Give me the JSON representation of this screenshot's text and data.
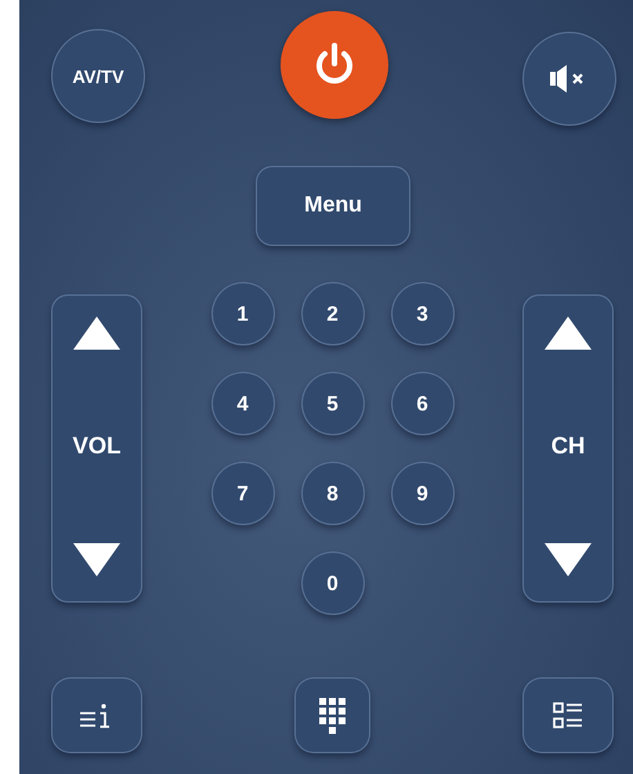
{
  "source_button": {
    "label": "AV/TV"
  },
  "menu_button": {
    "label": "Menu"
  },
  "volume": {
    "label": "VOL"
  },
  "channel": {
    "label": "CH"
  },
  "number_keys": [
    "1",
    "2",
    "3",
    "4",
    "5",
    "6",
    "7",
    "8",
    "9",
    "0"
  ]
}
